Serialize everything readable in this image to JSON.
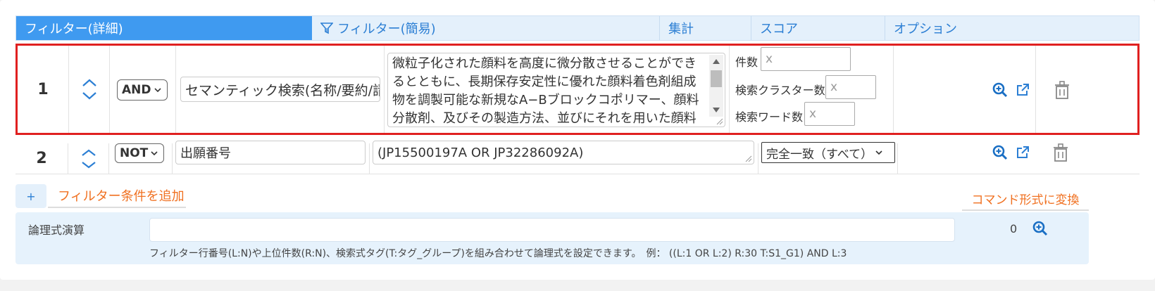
{
  "tabs": [
    {
      "label": "フィルター(詳細)"
    },
    {
      "label": "フィルター(簡易)"
    },
    {
      "label": "集計"
    },
    {
      "label": "スコア"
    },
    {
      "label": "オプション"
    }
  ],
  "rows": [
    {
      "number": "1",
      "operator": "AND",
      "field": "セマンティック検索(名称/要約/請",
      "query": "微粒子化された顔料を高度に微分散させることができるとともに、長期保存安定性に優れた顔料着色剤組成物を調製可能な新規なA−Bブロックコポリマー、顔料分散剤、及びその製造方法、並びにそれを用いた顔料",
      "params": [
        {
          "label": "件数",
          "placeholder": "x"
        },
        {
          "label": "検索クラスター数",
          "placeholder": "x"
        },
        {
          "label": "検索ワード数",
          "placeholder": "x"
        }
      ]
    },
    {
      "number": "2",
      "operator": "NOT",
      "field": "出願番号",
      "query": "(JP15500197A OR JP32286092A)",
      "match": "完全一致（すべて）"
    }
  ],
  "actions": {
    "plus": "+",
    "add_filter": "フィルター条件を追加",
    "convert": "コマンド形式に変換"
  },
  "logic": {
    "label": "論理式演算",
    "value": "",
    "count": "0",
    "help": "フィルター行番号(L:N)や上位件数(R:N)、検索式タグ(T:タグ_グループ)を組み合わせて論理式を設定できます。　例：  ((L:1 OR L:2) R:30 T:S1_G1) AND L:3"
  },
  "colors": {
    "accent": "#3f9af0",
    "highlight_border": "#e02020",
    "orange": "#f07020"
  }
}
